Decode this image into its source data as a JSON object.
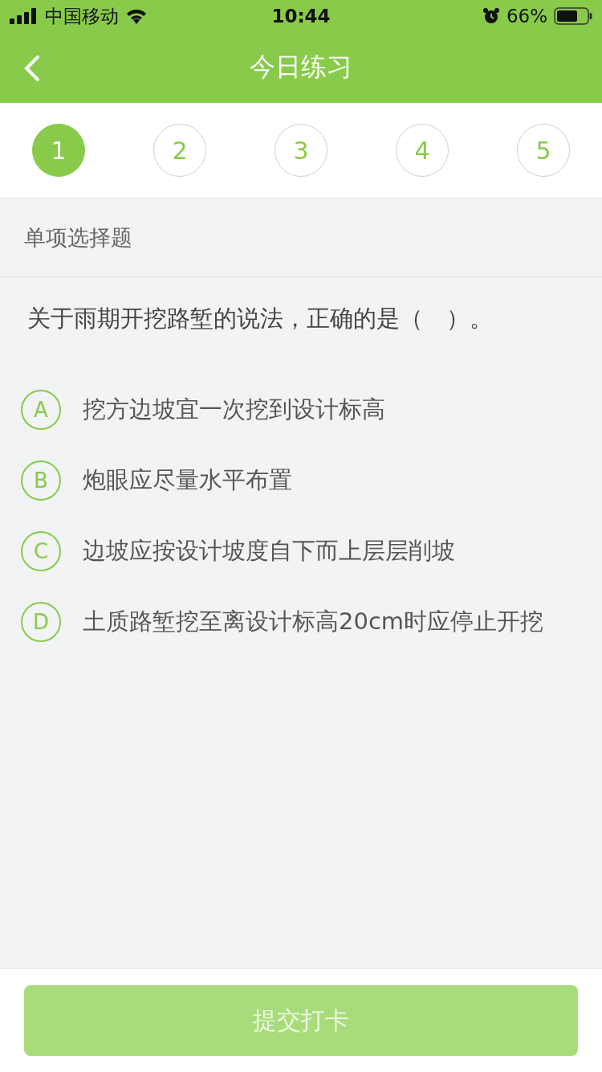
{
  "status_bar": {
    "carrier": "中国移动",
    "time": "10:44",
    "battery": "66%"
  },
  "nav_bar": {
    "title": "今日练习"
  },
  "steps": [
    {
      "label": "1",
      "selected": true
    },
    {
      "label": "2",
      "selected": false
    },
    {
      "label": "3",
      "selected": false
    },
    {
      "label": "4",
      "selected": false
    },
    {
      "label": "5",
      "selected": false
    }
  ],
  "section_title": "单项选择题",
  "question": "关于雨期开挖路堑的说法，正确的是（　）。",
  "options": [
    {
      "letter": "A",
      "text": "挖方边坡宜一次挖到设计标高",
      "selected": false
    },
    {
      "letter": "B",
      "text": "炮眼应尽量水平布置",
      "selected": false
    },
    {
      "letter": "C",
      "text": "边坡应按设计坡度自下而上层层削坡",
      "selected": false
    },
    {
      "letter": "D",
      "text": "土质路堑挖至离设计标高20cm时应停止开挖",
      "selected": false
    }
  ],
  "submit_button": {
    "label": "提交打卡",
    "disabled": true
  }
}
